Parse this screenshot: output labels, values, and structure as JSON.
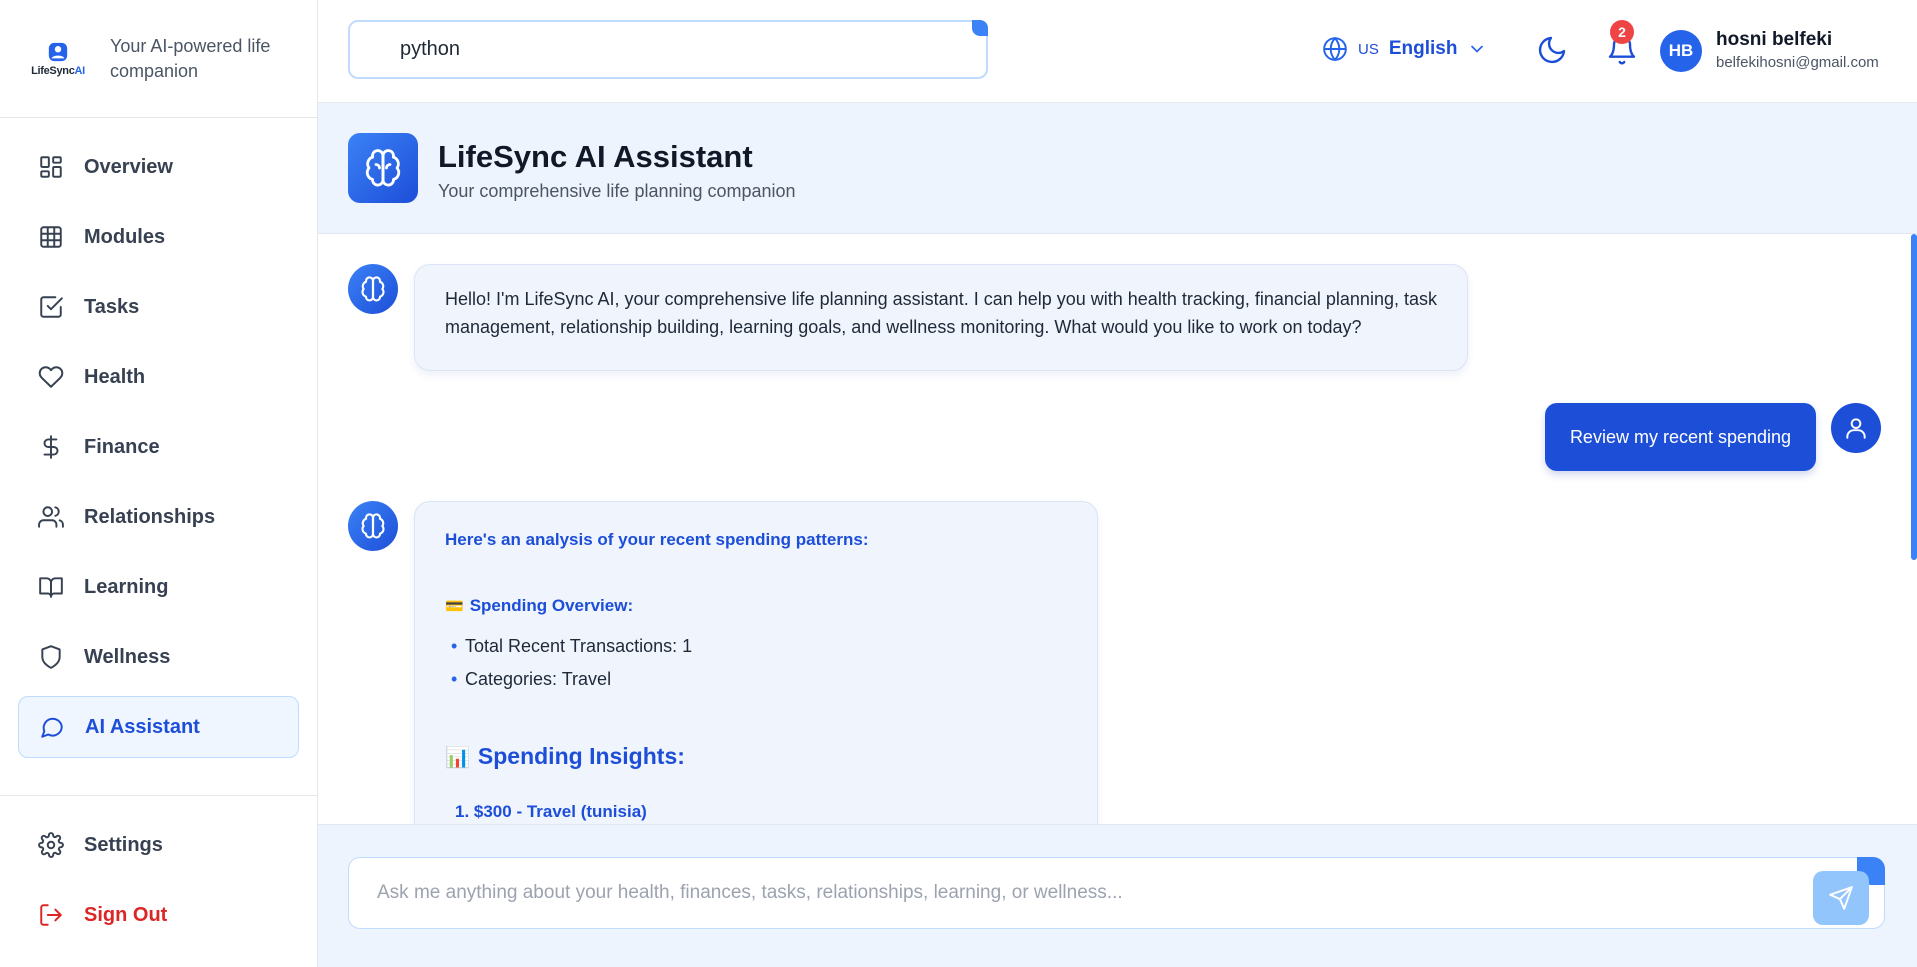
{
  "brand": {
    "logo_text_main": "LifeSync",
    "logo_text_ai": "AI",
    "tagline": "Your AI-powered life companion"
  },
  "sidebar": {
    "items": [
      {
        "label": "Overview",
        "icon": "overview-grid-icon"
      },
      {
        "label": "Modules",
        "icon": "modules-grid-icon"
      },
      {
        "label": "Tasks",
        "icon": "checkbox-icon"
      },
      {
        "label": "Health",
        "icon": "heart-icon"
      },
      {
        "label": "Finance",
        "icon": "dollar-icon"
      },
      {
        "label": "Relationships",
        "icon": "users-icon"
      },
      {
        "label": "Learning",
        "icon": "book-icon"
      },
      {
        "label": "Wellness",
        "icon": "shield-icon"
      },
      {
        "label": "AI Assistant",
        "icon": "chat-bubble-icon",
        "active": true
      }
    ],
    "bottom": [
      {
        "label": "Settings",
        "icon": "gear-icon"
      },
      {
        "label": "Sign Out",
        "icon": "sign-out-icon"
      }
    ]
  },
  "header": {
    "search_value": "python",
    "language_flag": "US",
    "language_label": "English",
    "notification_count": "2",
    "user": {
      "initials": "HB",
      "name": "hosni belfeki",
      "email": "belfekihosni@gmail.com"
    }
  },
  "page": {
    "title": "LifeSync AI Assistant",
    "subtitle": "Your comprehensive life planning companion"
  },
  "chat": {
    "messages": [
      {
        "role": "assistant",
        "text": "Hello! I'm LifeSync AI, your comprehensive life planning assistant. I can help you with health tracking, financial planning, task management, relationship building, learning goals, and wellness monitoring. What would you like to work on today?"
      },
      {
        "role": "user",
        "text": "Review my recent spending"
      },
      {
        "role": "assistant",
        "heading": "Here's an analysis of your recent spending patterns:",
        "overview_emoji": "💳",
        "overview_label": "Spending Overview:",
        "overview_items": [
          "Total Recent Transactions: 1",
          "Categories: Travel"
        ],
        "insights_emoji": "📊",
        "insights_label": "Spending Insights:",
        "insight_items": [
          "1. $300 - Travel (tunisia)"
        ]
      }
    ],
    "input_placeholder": "Ask me anything about your health, finances, tasks, relationships, learning, or wellness..."
  },
  "colors": {
    "primary": "#1d4ed8",
    "accent": "#3b82f6",
    "danger": "#dc2626",
    "badge": "#ef4444"
  }
}
